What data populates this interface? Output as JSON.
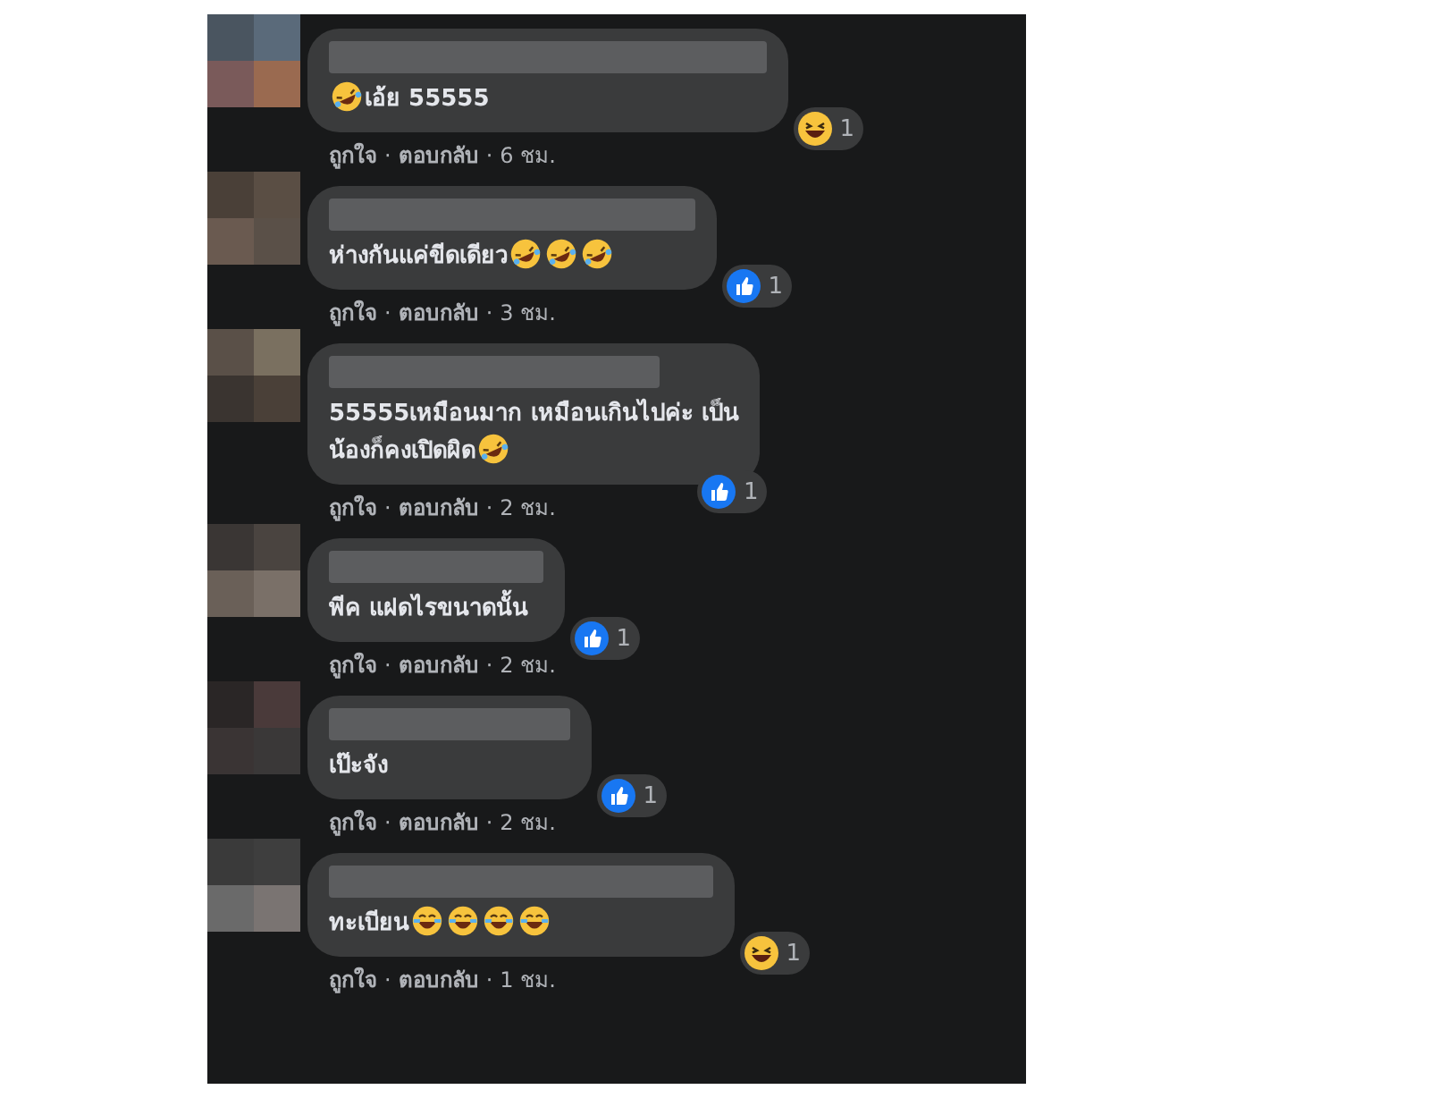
{
  "separator": "·",
  "comments": [
    {
      "emojis_before": [
        {
          "kind": "rolling"
        }
      ],
      "lines": [
        "เอ้ย 55555"
      ],
      "reaction": {
        "kind": "haha",
        "count": "1"
      },
      "actions": [
        "ถูกใจ",
        "ตอบกลับ"
      ],
      "time": "6 ชม."
    },
    {
      "lines": [
        "ห่างกันแค่ขีดเดียว"
      ],
      "emojis_after": [
        {
          "kind": "rolling"
        },
        {
          "kind": "rolling"
        },
        {
          "kind": "rolling"
        }
      ],
      "reaction": {
        "kind": "like",
        "count": "1"
      },
      "actions": [
        "ถูกใจ",
        "ตอบกลับ"
      ],
      "time": "3 ชม."
    },
    {
      "lines": [
        "55555เหมือนมาก เหมือนเกินไปค่ะ เป็น",
        "น้องก็คงเปิดผิด"
      ],
      "emojis_after": [
        {
          "kind": "rolling"
        }
      ],
      "reaction": {
        "kind": "like",
        "count": "1"
      },
      "actions": [
        "ถูกใจ",
        "ตอบกลับ"
      ],
      "time": "2 ชม."
    },
    {
      "lines": [
        "พีค แฝดไรขนาดนั้น"
      ],
      "reaction": {
        "kind": "like",
        "count": "1"
      },
      "actions": [
        "ถูกใจ",
        "ตอบกลับ"
      ],
      "time": "2 ชม."
    },
    {
      "lines": [
        "เป๊ะจัง"
      ],
      "reaction": {
        "kind": "like",
        "count": "1"
      },
      "actions": [
        "ถูกใจ",
        "ตอบกลับ"
      ],
      "time": "2 ชม."
    },
    {
      "lines": [
        "ทะเบียน"
      ],
      "emojis_after": [
        {
          "kind": "joy"
        },
        {
          "kind": "joy"
        },
        {
          "kind": "joy"
        },
        {
          "kind": "joy"
        }
      ],
      "reaction": {
        "kind": "haha",
        "count": "1"
      },
      "actions": [
        "ถูกใจ",
        "ตอบกลับ"
      ],
      "time": "1 ชม."
    }
  ]
}
